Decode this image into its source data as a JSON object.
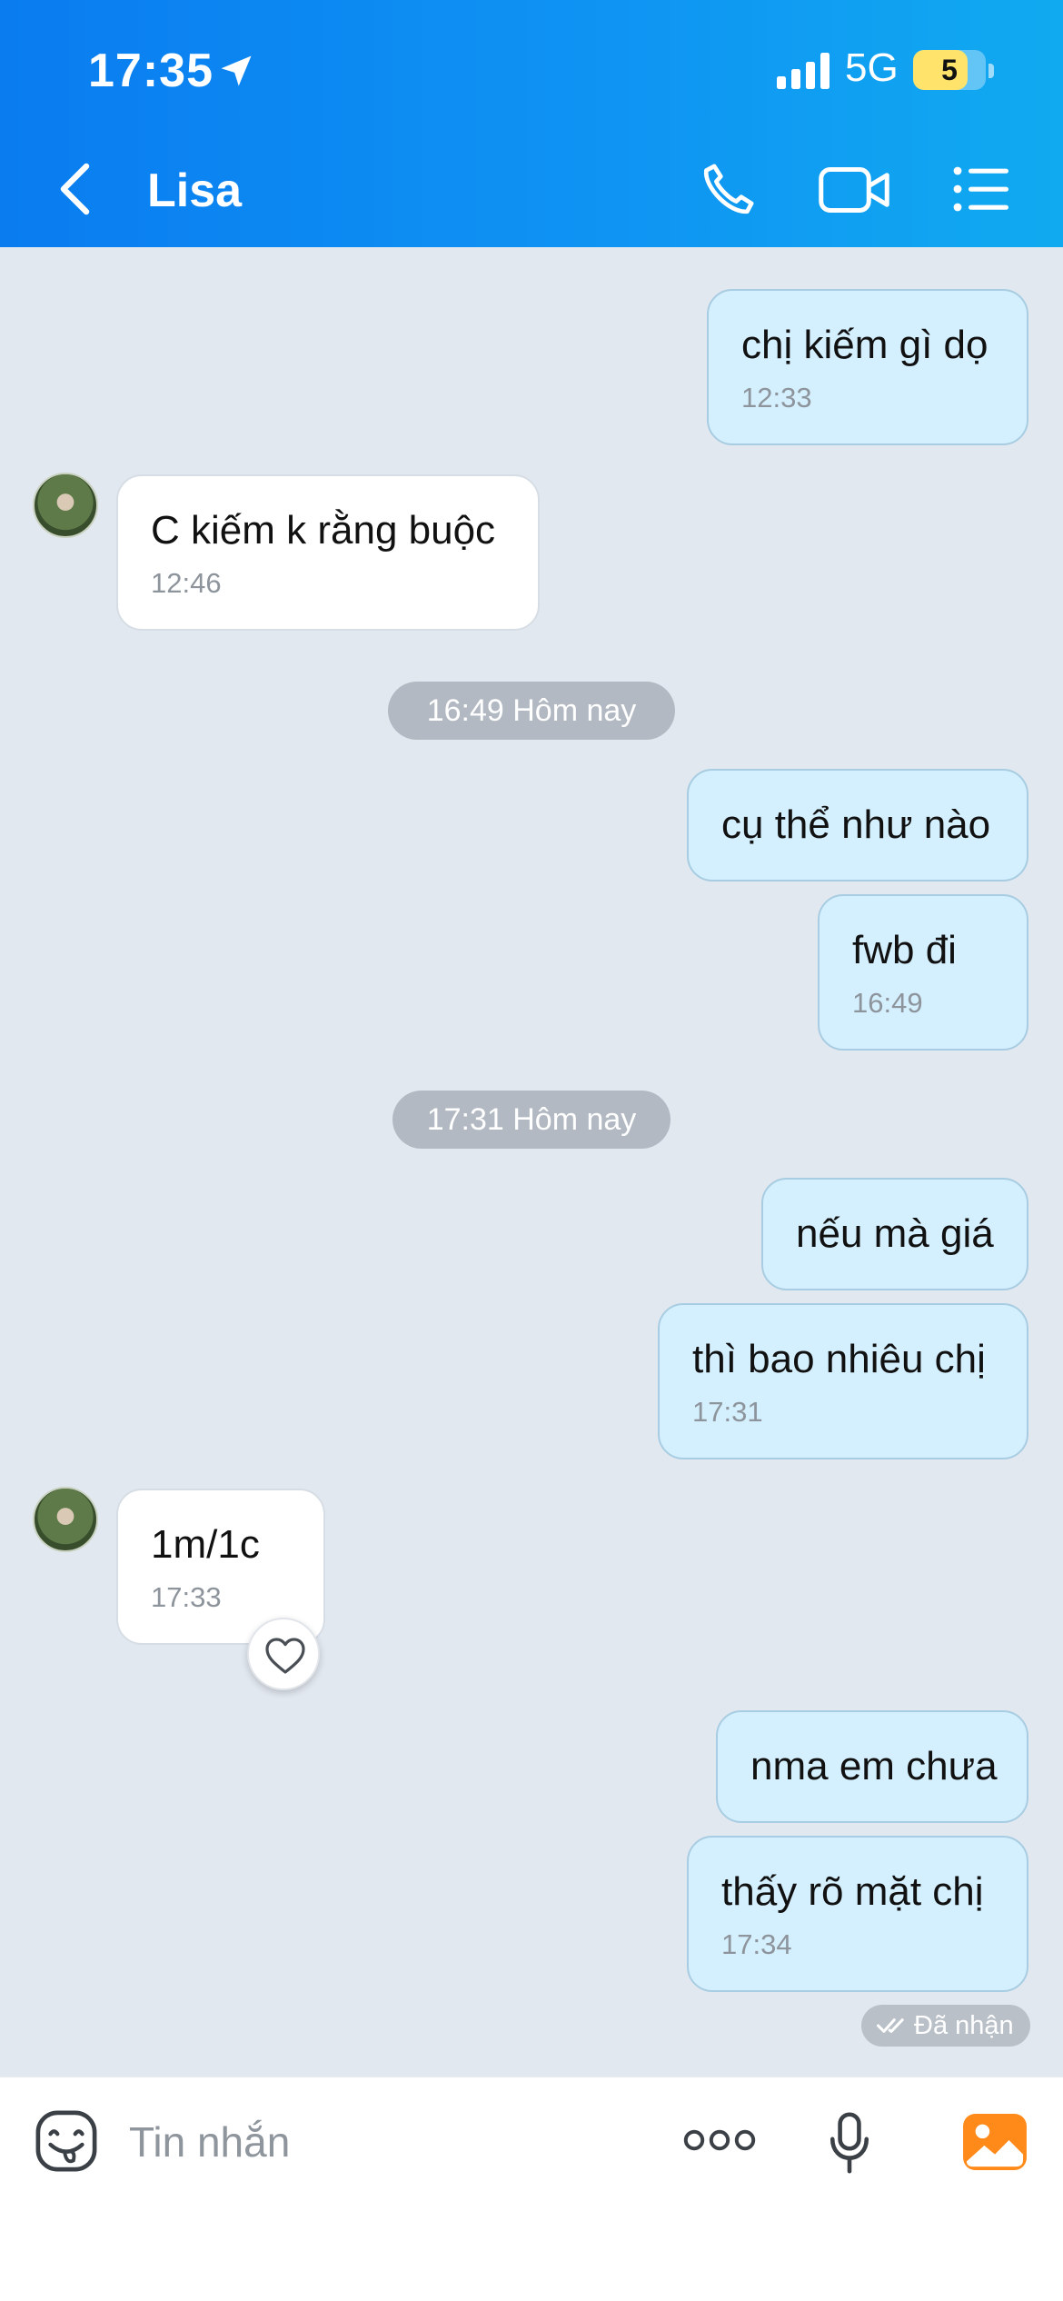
{
  "status_bar": {
    "time": "17:35",
    "network": "5G",
    "battery": "5"
  },
  "header": {
    "contact_name": "Lisa"
  },
  "messages": [
    {
      "text": "chị kiếm gì dọ",
      "time": "12:33"
    },
    {
      "text": "C kiếm k rằng buộc",
      "time": "12:46"
    },
    {
      "text": "cụ thể như nào"
    },
    {
      "text": "fwb đi",
      "time": "16:49"
    },
    {
      "text": "nếu mà giá"
    },
    {
      "text": "thì bao nhiêu chị",
      "time": "17:31"
    },
    {
      "text": "1m/1c",
      "time": "17:33"
    },
    {
      "text": "nma em chưa"
    },
    {
      "text": "thấy rõ mặt chị",
      "time": "17:34"
    }
  ],
  "separators": [
    "16:49 Hôm nay",
    "17:31 Hôm nay"
  ],
  "receipt": "Đã nhận",
  "composer": {
    "placeholder": "Tin nhắn"
  },
  "colors": {
    "header": "#0f95f3",
    "outgoing_bubble": "#d4effd",
    "incoming_bubble": "#ffffff",
    "chat_bg": "#e2e8f0"
  }
}
